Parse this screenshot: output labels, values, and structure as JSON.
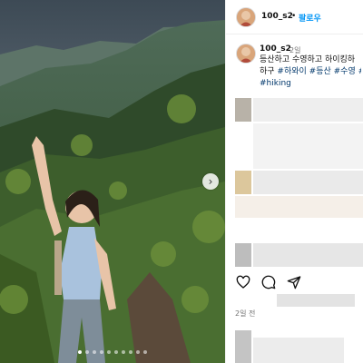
{
  "post": {
    "username": "100_s2",
    "follow_label": "팔로우",
    "separator": "•",
    "time_ago": "2일",
    "caption_line1": "등산하고 수영하고 하이킹하",
    "caption_line2_text": "하구 ",
    "caption_tags_line2": "#하와이 #등산 #수영 #",
    "caption_tags_line3": "#hiking",
    "date": "2일 전"
  },
  "carousel": {
    "next_icon": "chevron-right-icon",
    "dots_total": 10,
    "active_dot": 0
  },
  "actions": {
    "like_icon": "heart-icon",
    "comment_icon": "comment-icon",
    "share_icon": "send-icon"
  },
  "colors": {
    "follow": "#0095f6",
    "hashtag": "#00376b"
  }
}
